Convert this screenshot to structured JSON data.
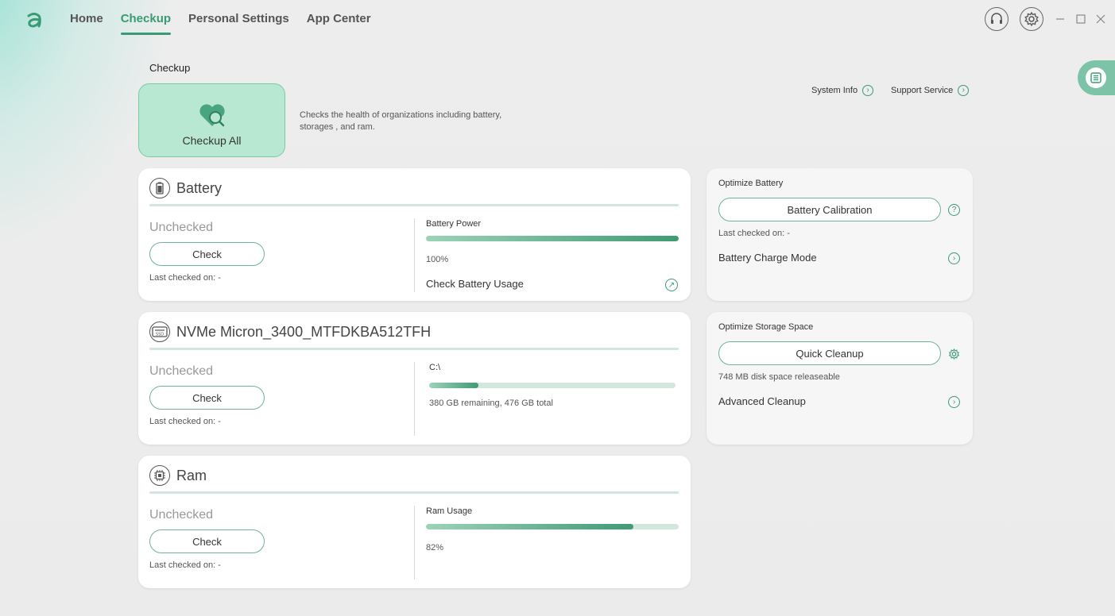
{
  "nav": {
    "items": [
      {
        "label": "Home",
        "active": false
      },
      {
        "label": "Checkup",
        "active": true
      },
      {
        "label": "Personal Settings",
        "active": false
      },
      {
        "label": "App Center",
        "active": false
      }
    ]
  },
  "header": {
    "section_title": "Checkup",
    "checkup_all_label": "Checkup All",
    "description": "Checks the health of organizations including battery, storages , and ram.",
    "system_info_label": "System Info",
    "support_service_label": "Support Service"
  },
  "battery": {
    "title": "Battery",
    "status": "Unchecked",
    "check_label": "Check",
    "last_checked": "Last checked on: -",
    "metric_label": "Battery Power",
    "metric_percent": 100,
    "metric_value": "100%",
    "link_label": "Check Battery Usage"
  },
  "storage": {
    "title": "NVMe Micron_3400_MTFDKBA512TFH",
    "status": "Unchecked",
    "check_label": "Check",
    "last_checked": "Last checked on: -",
    "drive_label": "C:\\",
    "used_fraction": 0.2,
    "usage_text": "380 GB remaining, 476 GB total"
  },
  "ram": {
    "title": "Ram",
    "status": "Unchecked",
    "check_label": "Check",
    "last_checked": "Last checked on: -",
    "metric_label": "Ram Usage",
    "metric_percent": 82,
    "metric_value": "82%"
  },
  "optimize_battery": {
    "title": "Optimize Battery",
    "button_label": "Battery Calibration",
    "last_checked": "Last checked on: -",
    "link_label": "Battery Charge Mode"
  },
  "optimize_storage": {
    "title": "Optimize Storage Space",
    "button_label": "Quick Cleanup",
    "releasable": "748 MB disk space releaseable",
    "link_label": "Advanced Cleanup"
  },
  "colors": {
    "accent": "#3a9a73",
    "checkup_tile": "#b9e8d2"
  }
}
